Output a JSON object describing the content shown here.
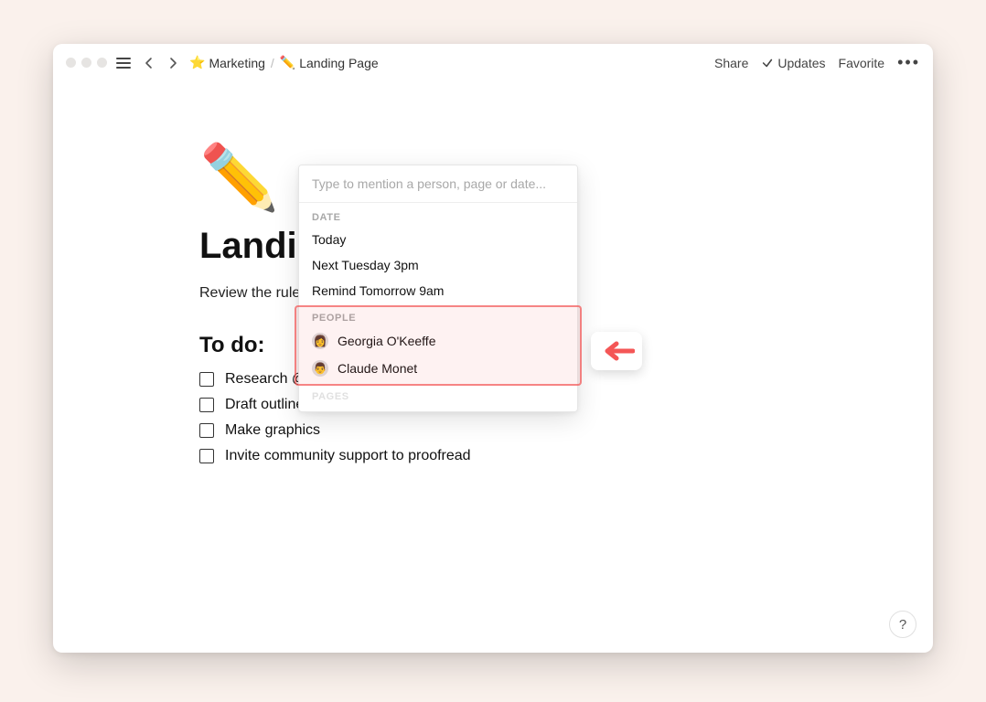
{
  "breadcrumb": {
    "star_icon": "⭐",
    "parent_label": "Marketing",
    "pencil_icon": "✏️",
    "page_label": "Landing Page"
  },
  "top_actions": {
    "share": "Share",
    "updates": "Updates",
    "favorite": "Favorite"
  },
  "page": {
    "icon": "✏️",
    "title": "Landing Page",
    "body_text": "Review the rules",
    "todo_heading": "To do:",
    "todos": [
      "Research @",
      "Draft outline",
      "Make graphics",
      "Invite community support to proofread"
    ]
  },
  "mention_popup": {
    "placeholder": "Type to mention a person, page or date...",
    "sections": {
      "date": {
        "label": "DATE",
        "items": [
          "Today",
          "Next Tuesday 3pm",
          "Remind Tomorrow 9am"
        ]
      },
      "people": {
        "label": "PEOPLE",
        "items": [
          "Georgia O'Keeffe",
          "Claude Monet"
        ]
      },
      "pages": {
        "label": "PAGES"
      }
    }
  },
  "help_label": "?"
}
